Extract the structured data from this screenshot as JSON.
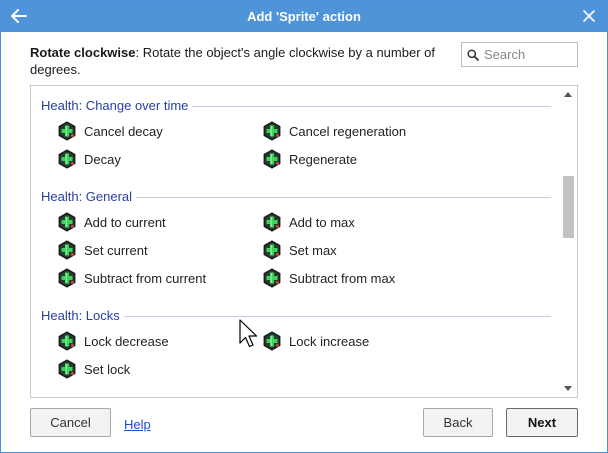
{
  "window": {
    "title": "Add 'Sprite' action",
    "back_icon": "arrow-left-icon",
    "close_icon": "close-icon"
  },
  "description": {
    "name": "Rotate clockwise",
    "text": ": Rotate the object's angle clockwise by a number of degrees."
  },
  "search": {
    "placeholder": "Search",
    "icon": "search-icon"
  },
  "groups": [
    {
      "title": "Health: Change over time",
      "items": [
        "Cancel decay",
        "Cancel regeneration",
        "Decay",
        "Regenerate"
      ]
    },
    {
      "title": "Health: General",
      "items": [
        "Add to current",
        "Add to max",
        "Set current",
        "Set max",
        "Subtract from current",
        "Subtract from max"
      ]
    },
    {
      "title": "Health: Locks",
      "items": [
        "Lock decrease",
        "Lock increase",
        "Set lock"
      ]
    }
  ],
  "item_icon": "health-cross-icon",
  "colors": {
    "titlebar": "#4f93d8",
    "group_header": "#2a3fa0",
    "link": "#1a4fd0",
    "icon_cross": "#3bd45a"
  },
  "footer": {
    "cancel_label": "Cancel",
    "help_label": "Help",
    "back_label": "Back",
    "next_label": "Next"
  }
}
